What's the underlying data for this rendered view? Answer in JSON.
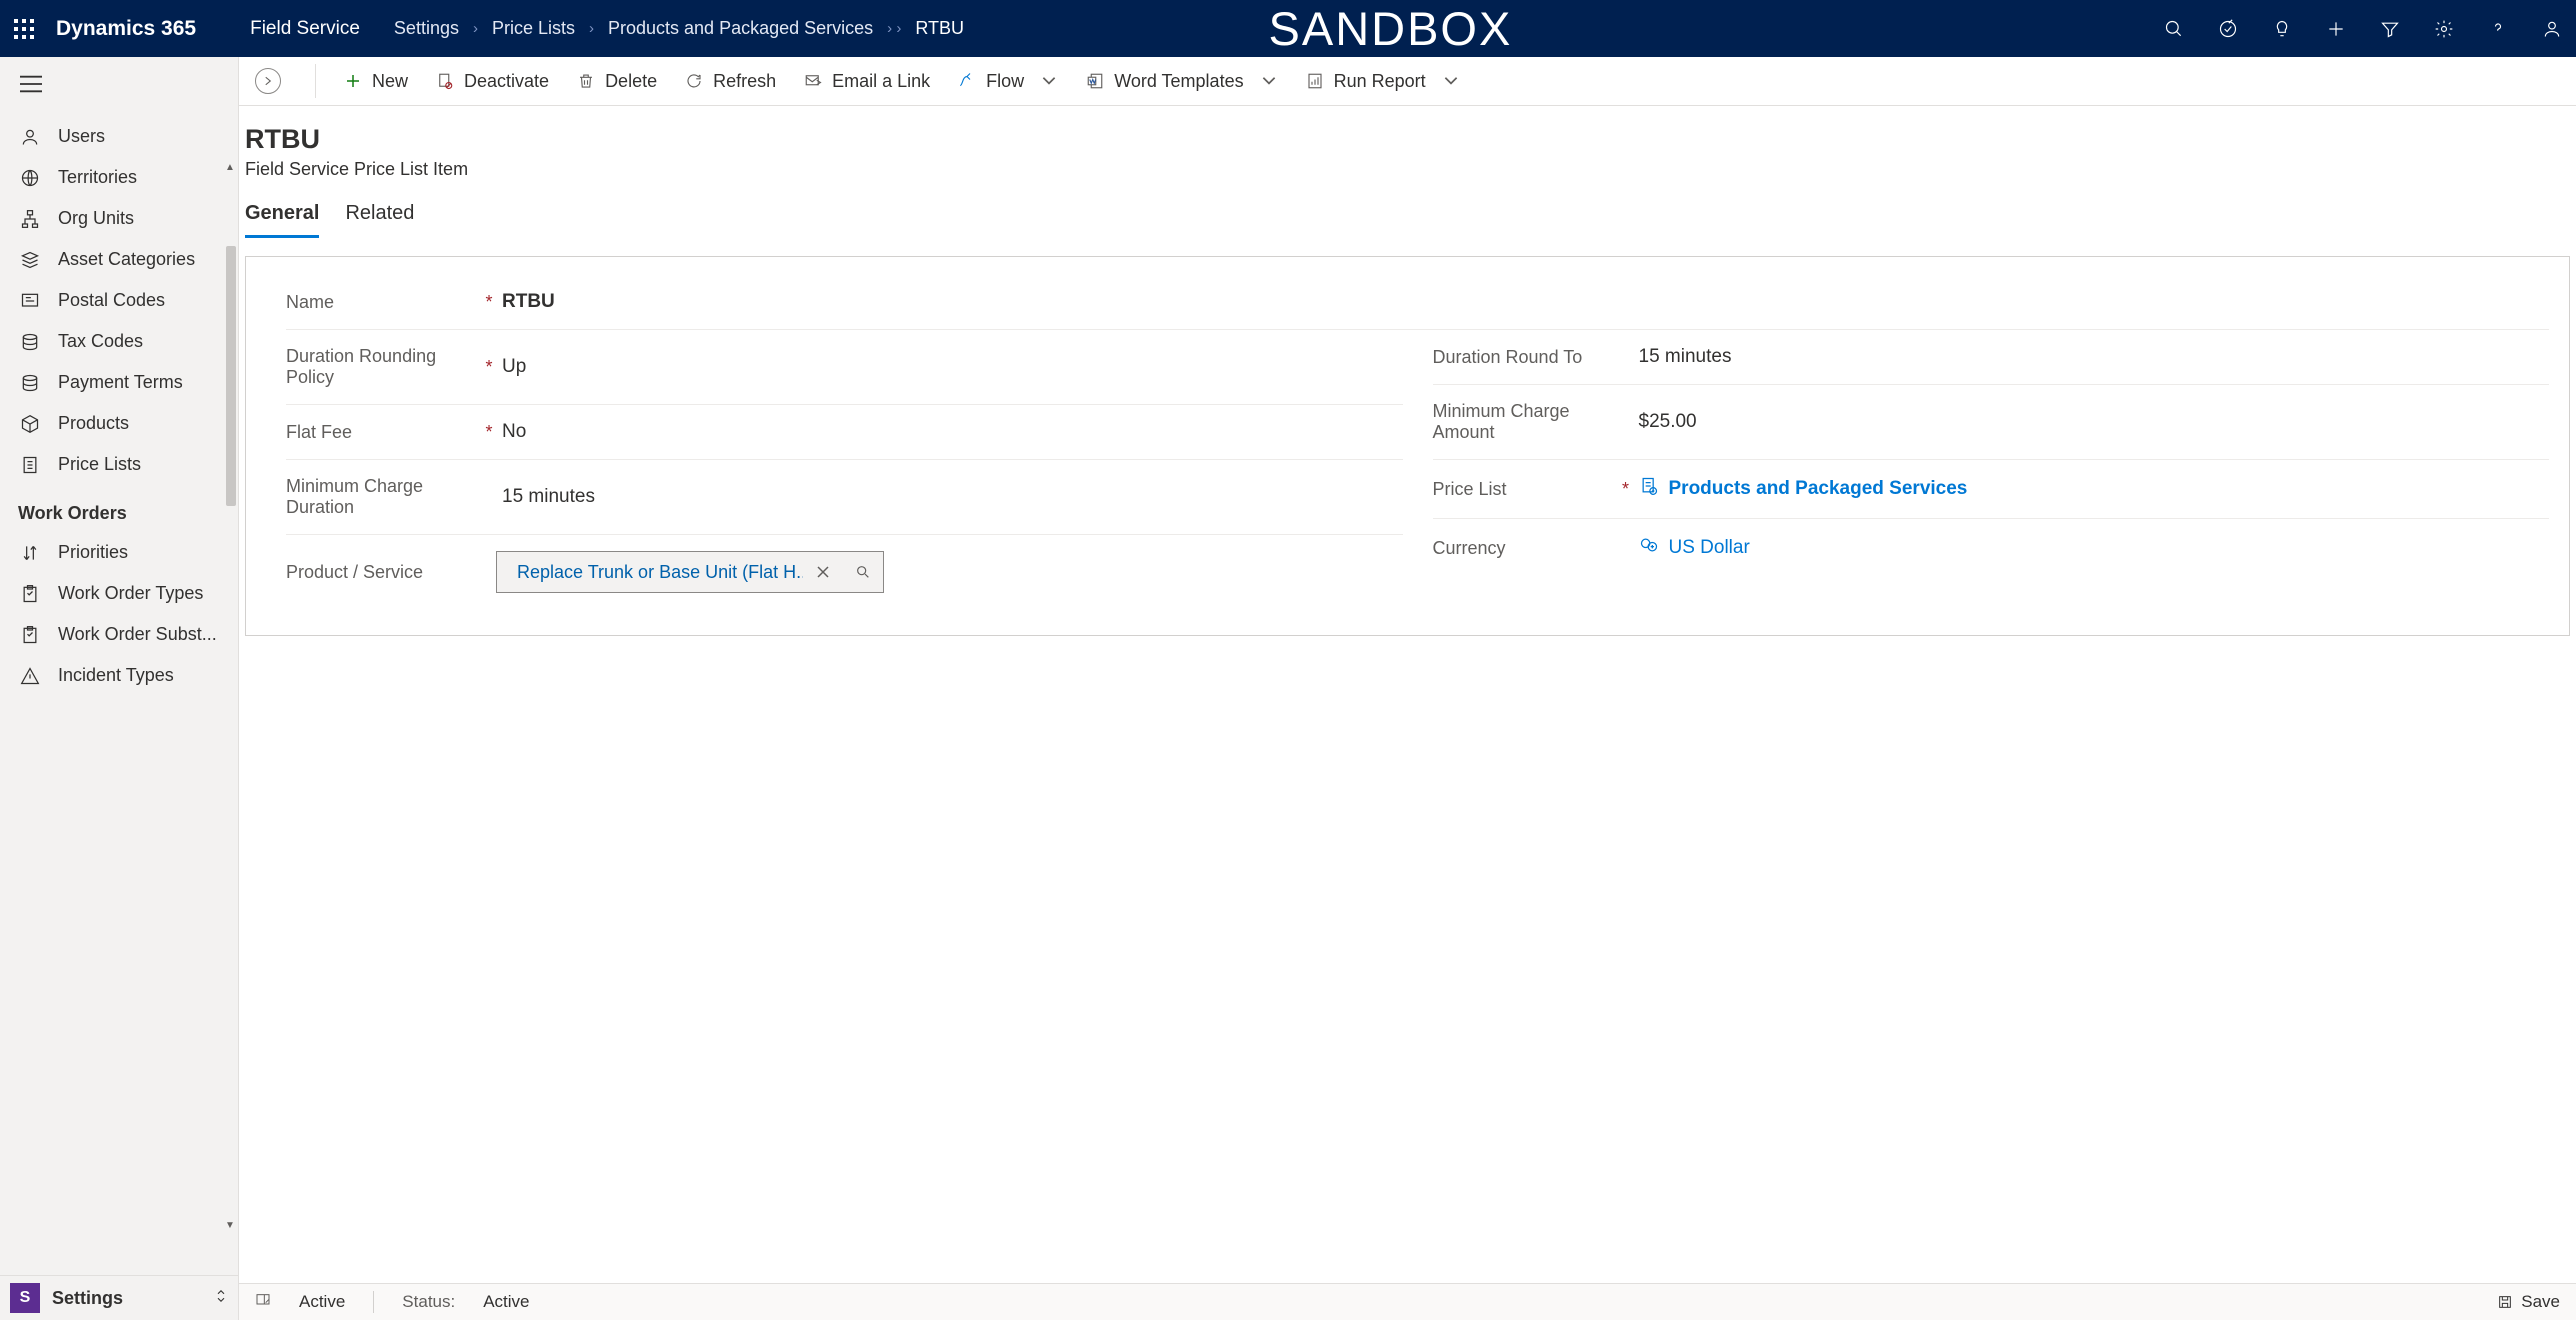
{
  "header": {
    "brand": "Dynamics 365",
    "app": "Field Service",
    "sandbox": "SANDBOX",
    "breadcrumbs": [
      "Settings",
      "Price Lists",
      "Products and Packaged Services"
    ],
    "breadcrumb_current": "RTBU"
  },
  "commands": {
    "new": "New",
    "deactivate": "Deactivate",
    "delete": "Delete",
    "refresh": "Refresh",
    "email": "Email a Link",
    "flow": "Flow",
    "word": "Word Templates",
    "report": "Run Report"
  },
  "sidebar": {
    "items": [
      {
        "label": "Users",
        "icon": "person"
      },
      {
        "label": "Territories",
        "icon": "globe"
      },
      {
        "label": "Org Units",
        "icon": "org"
      },
      {
        "label": "Asset Categories",
        "icon": "asset"
      },
      {
        "label": "Postal Codes",
        "icon": "postal"
      },
      {
        "label": "Tax Codes",
        "icon": "stack"
      },
      {
        "label": "Payment Terms",
        "icon": "stack"
      },
      {
        "label": "Products",
        "icon": "box"
      },
      {
        "label": "Price Lists",
        "icon": "doc"
      }
    ],
    "group1": "Work Orders",
    "items2": [
      {
        "label": "Priorities",
        "icon": "priority"
      },
      {
        "label": "Work Order Types",
        "icon": "clipboard"
      },
      {
        "label": "Work Order Subst...",
        "icon": "clipboard"
      },
      {
        "label": "Incident Types",
        "icon": "warning"
      }
    ],
    "area": {
      "badge": "S",
      "name": "Settings"
    }
  },
  "page": {
    "title": "RTBU",
    "subtitle": "Field Service Price List Item",
    "tabs": {
      "general": "General",
      "related": "Related"
    }
  },
  "form": {
    "name": {
      "label": "Name",
      "value": "RTBU",
      "required": true
    },
    "drp": {
      "label": "Duration Rounding Policy",
      "value": "Up",
      "required": true
    },
    "drt": {
      "label": "Duration Round To",
      "value": "15 minutes"
    },
    "flat": {
      "label": "Flat Fee",
      "value": "No",
      "required": true
    },
    "mca": {
      "label": "Minimum Charge Amount",
      "value": "$25.00"
    },
    "mcd": {
      "label": "Minimum Charge Duration",
      "value": "15 minutes"
    },
    "pl": {
      "label": "Price List",
      "value": "Products and Packaged Services",
      "required": true
    },
    "ps": {
      "label": "Product / Service",
      "value": "Replace Trunk or Base Unit (Flat H..."
    },
    "cur": {
      "label": "Currency",
      "value": "US Dollar"
    }
  },
  "status": {
    "state_label": "Active",
    "status_label": "Status:",
    "status_value": "Active",
    "save": "Save"
  }
}
